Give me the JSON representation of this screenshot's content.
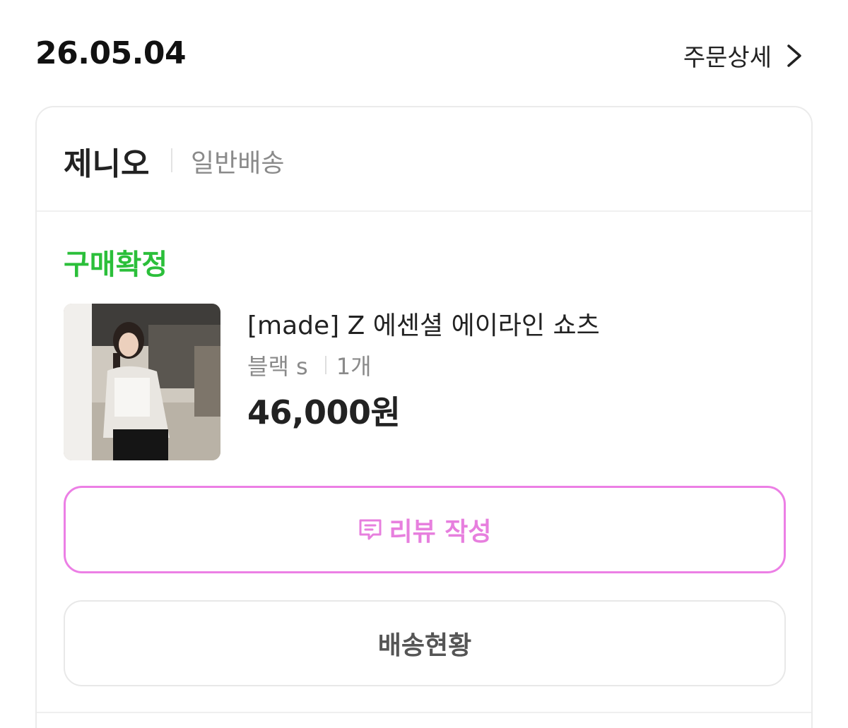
{
  "order": {
    "date": "26.05.04",
    "detail_label": "주문상세"
  },
  "seller": {
    "name": "제니오",
    "shipping_type": "일반배송"
  },
  "status": {
    "label": "구매확정",
    "color": "#2bbf3a"
  },
  "product": {
    "name": "[made] Z 에센셜 에이라인 쇼츠",
    "option": "블랙 s",
    "quantity": "1개",
    "price": "46,000원"
  },
  "actions": {
    "review_label": "리뷰 작성",
    "shipping_status_label": "배송현황",
    "accent_color": "#ec7fe5"
  },
  "icons": {
    "chevron": "chevron-right-icon",
    "review": "review-speech-icon"
  }
}
